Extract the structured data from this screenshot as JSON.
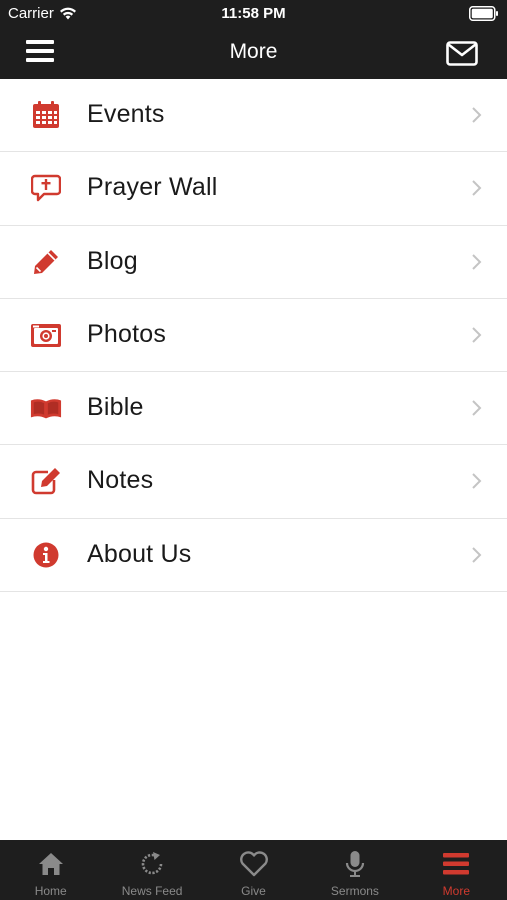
{
  "status_bar": {
    "carrier": "Carrier",
    "time": "11:58 PM"
  },
  "nav": {
    "title": "More",
    "menu_icon": "hamburger-menu-icon",
    "mail_icon": "envelope-icon"
  },
  "accent_color": "#d03a2f",
  "bar_color": "#1e1e1e",
  "menu_items": [
    {
      "label": "Events",
      "icon": "calendar-icon"
    },
    {
      "label": "Prayer Wall",
      "icon": "prayer-bubble-icon"
    },
    {
      "label": "Blog",
      "icon": "pencil-icon"
    },
    {
      "label": "Photos",
      "icon": "camera-icon"
    },
    {
      "label": "Bible",
      "icon": "open-book-icon"
    },
    {
      "label": "Notes",
      "icon": "edit-note-icon"
    },
    {
      "label": "About Us",
      "icon": "info-icon"
    }
  ],
  "tabs": [
    {
      "label": "Home",
      "icon": "home-icon",
      "active": false
    },
    {
      "label": "News Feed",
      "icon": "refresh-icon",
      "active": false
    },
    {
      "label": "Give",
      "icon": "heart-icon",
      "active": false
    },
    {
      "label": "Sermons",
      "icon": "microphone-icon",
      "active": false
    },
    {
      "label": "More",
      "icon": "menu-lines-icon",
      "active": true
    }
  ]
}
